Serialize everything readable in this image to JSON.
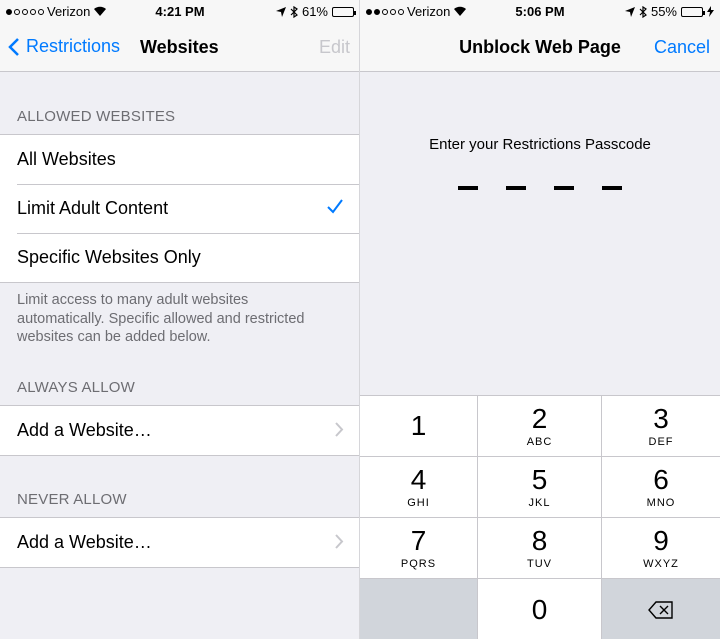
{
  "left": {
    "status": {
      "carrier": "Verizon",
      "time": "4:21 PM",
      "battery": "61%"
    },
    "nav": {
      "back_label": "Restrictions",
      "title": "Websites",
      "edit_label": "Edit"
    },
    "allowed": {
      "header": "ALLOWED WEBSITES",
      "items": [
        {
          "label": "All Websites",
          "checked": false
        },
        {
          "label": "Limit Adult Content",
          "checked": true
        },
        {
          "label": "Specific Websites Only",
          "checked": false
        }
      ],
      "footnote": "Limit access to many adult websites automatically. Specific allowed and restricted websites can be added below."
    },
    "always_allow": {
      "header": "ALWAYS ALLOW",
      "add_label": "Add a Website…"
    },
    "never_allow": {
      "header": "NEVER ALLOW",
      "add_label": "Add a Website…"
    }
  },
  "right": {
    "status": {
      "carrier": "Verizon",
      "time": "5:06 PM",
      "battery": "55%"
    },
    "nav": {
      "title": "Unblock Web Page",
      "cancel_label": "Cancel"
    },
    "prompt": "Enter your Restrictions Passcode",
    "keys": [
      {
        "num": "1",
        "letters": ""
      },
      {
        "num": "2",
        "letters": "ABC"
      },
      {
        "num": "3",
        "letters": "DEF"
      },
      {
        "num": "4",
        "letters": "GHI"
      },
      {
        "num": "5",
        "letters": "JKL"
      },
      {
        "num": "6",
        "letters": "MNO"
      },
      {
        "num": "7",
        "letters": "PQRS"
      },
      {
        "num": "8",
        "letters": "TUV"
      },
      {
        "num": "9",
        "letters": "WXYZ"
      },
      {
        "num": "0",
        "letters": ""
      }
    ]
  },
  "colors": {
    "accent": "#007aff",
    "background": "#efeff4",
    "separator": "#c8c7cc",
    "battery_charging": "#4cd964"
  }
}
